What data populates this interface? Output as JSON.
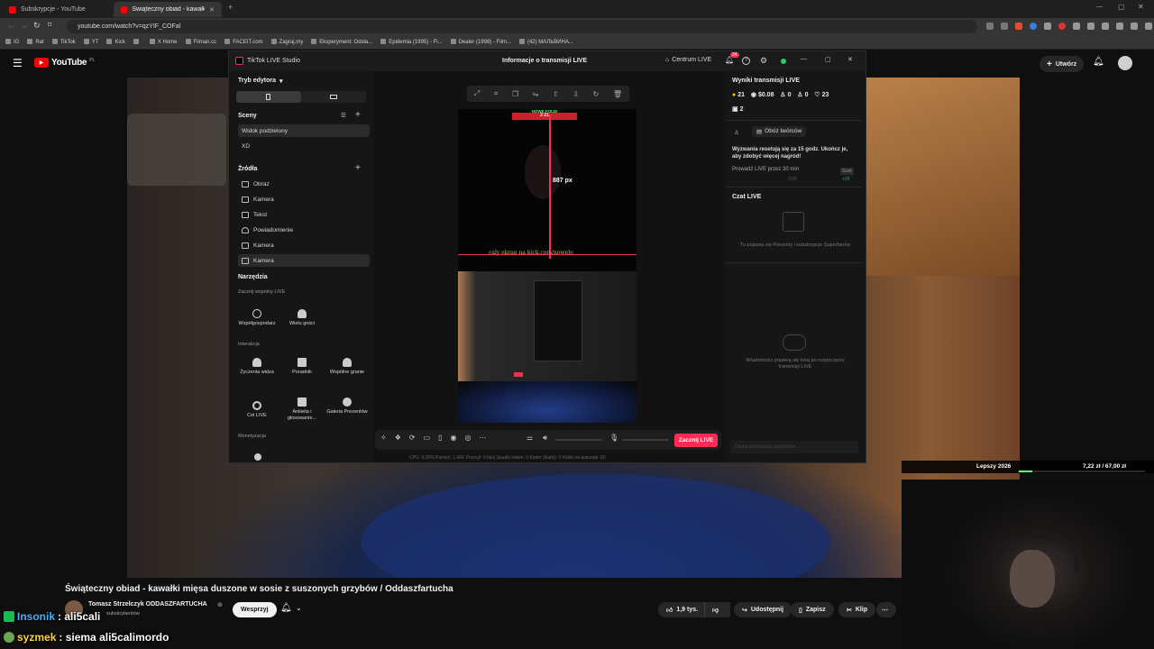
{
  "browser": {
    "tabs": [
      {
        "label": "Subskrypcje - YouTube",
        "active": false
      },
      {
        "label": "Świąteczny obiad - kawałki mięs",
        "active": true
      }
    ],
    "url": "youtube.com/watch?v=qzYIF_COFal",
    "bookmarks": [
      "IG",
      "Rat",
      "TikTok",
      "YT",
      "Kick",
      "",
      "X Home",
      "Filman.cc",
      "FACEIT.com",
      "Zagraj.my",
      "Eksperyment: Odsła...",
      "Epidemia (1995) - Fi...",
      "Dealer (1998) - Film...",
      "(42) МАЛЬВИНА..."
    ]
  },
  "youtube": {
    "logo": "YouTube",
    "logo_region": "PL",
    "create_label": "Utwórz",
    "video_title": "Świąteczny obiad - kawałki mięsa duszone w sosie z suszonych grzybów / Oddaszfartucha",
    "channel_name": "Tomasz Strzelczyk ODDASZFARTUCHA",
    "channel_subs": "subskrybentów",
    "support_label": "Wesprzyj",
    "likes": "1,9 tys.",
    "share_label": "Udostępnij",
    "save_label": "Zapisz",
    "clip_label": "Klip"
  },
  "studio": {
    "app_title": "TikTok LIVE Studio",
    "center_title": "Informacje o transmisji LIVE",
    "live_center": "Centrum LIVE",
    "notification_count": "24",
    "editor_mode": "Tryb edytora",
    "scenes_title": "Sceny",
    "scenes": [
      "Widok podzielony",
      "XD"
    ],
    "sources_title": "Źródła",
    "sources": [
      {
        "label": "Obraz",
        "icon": "image-icon"
      },
      {
        "label": "Kamera",
        "icon": "camera-icon"
      },
      {
        "label": "Tekst",
        "icon": "text-icon"
      },
      {
        "label": "Powiadomienie",
        "icon": "bell-icon"
      },
      {
        "label": "Kamera",
        "icon": "camera-icon"
      },
      {
        "label": "Kamera",
        "icon": "camera-icon"
      }
    ],
    "tools_title": "Narzędzia",
    "tools_live": "Zacznij wspólny LIVE",
    "tools_row1": [
      "Współgospodarz",
      "Wielu gości"
    ],
    "interaction_title": "Interakcja",
    "tools_row2": [
      "Życzenia widza",
      "Poradnik",
      "Wspólne granie"
    ],
    "tools_row3": [
      "Cel LIVE",
      "Ankieta i głosowanie...",
      "Galeria Prezentów"
    ],
    "monetization_title": "Monetyzacja",
    "preview_banner": "NOWE FOLDI",
    "preview_timer": "2 21",
    "preview_measure": "887 px",
    "preview_overlay_text": "caly ekran na kick.com/nowelo",
    "go_live": "Zacznij LIVE",
    "status_bar": "CPU: 3.28%    Pamięć: 1.46K    Przesył: 0 kb/s    Spadki klatek: 0    Koder (klatki): 0    Klatki na sekundę: 60",
    "results_title": "Wyniki transmisji LIVE",
    "stats": {
      "coins": "21",
      "money": "$0.08",
      "viewers": "0",
      "follows": "0",
      "likes": "23",
      "gifts": "2"
    },
    "creators_camp": "Obóz twórców",
    "challenge_text": "Wyzwania resetują się za 15 godz. Ukończ je, aby zdobyć więcej nagród!",
    "challenge_item": "Prowadź LIVE przez 30 min",
    "challenge_progress": "0/30",
    "challenge_reward": "+20",
    "challenge_badge": "Gold",
    "chat_title": "Czat LIVE",
    "gifts_placeholder": "Tu pojawią się Prezenty i subskrypcje Superfanów",
    "messages_placeholder": "Wiadomości pojawią się tutaj po rozpoczęciu transmisji LIVE",
    "comment_placeholder": "Dodaj komentarz publicznie..."
  },
  "overlay": {
    "chat": [
      {
        "user": "Insonik",
        "message": ": ali5cali"
      },
      {
        "user": "syzmek",
        "message": ": siema ali5calimordo"
      }
    ],
    "ticker_left": "Lepszy 2026",
    "ticker_right": "7,22 zł / 67,00 zł"
  },
  "colors": {
    "tiktok_red": "#fe2c55",
    "youtube_red": "#ff0000",
    "chat_user1": "#3fb1ff",
    "chat_user2": "#ffd23f"
  }
}
